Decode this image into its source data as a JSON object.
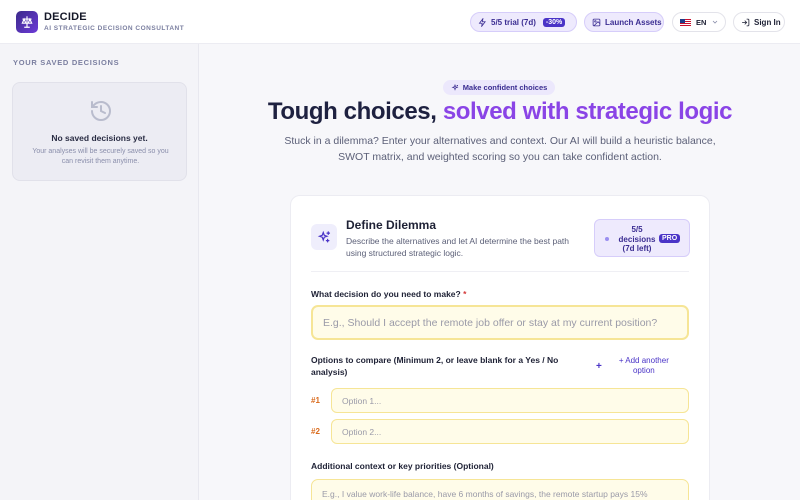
{
  "header": {
    "brand_name": "DECIDE",
    "brand_tagline": "AI STRATEGIC DECISION CONSULTANT",
    "trial_label": "5/5 trial (7d)",
    "trial_discount": "-30%",
    "launch_assets_label": "Launch Assets",
    "language_code": "EN",
    "sign_in_label": "Sign In"
  },
  "sidebar": {
    "title": "YOUR SAVED DECISIONS",
    "empty_title": "No saved decisions yet.",
    "empty_description": "Your analyses will be securely saved so you can revisit them anytime."
  },
  "hero": {
    "pill_label": "Make confident choices",
    "title_part1": "Tough choices,",
    "title_part2": "solved with strategic logic",
    "subtitle": "Stuck in a dilemma? Enter your alternatives and context. Our AI will build a heuristic balance, SWOT matrix, and weighted scoring so you can take confident action."
  },
  "card": {
    "title": "Define Dilemma",
    "description": "Describe the alternatives and let AI determine the best path using structured strategic logic.",
    "quota_label": "5/5 decisions (7d left)",
    "quota_badge": "PRO",
    "decision_label": "What decision do you need to make?",
    "decision_required_mark": "*",
    "decision_placeholder": "E.g., Should I accept the remote job offer or stay at my current position?",
    "options_label": "Options to compare (Minimum 2, or leave blank for a Yes / No analysis)",
    "add_option_label": "+ Add another option",
    "options": [
      {
        "number": "#1",
        "placeholder": "Option 1..."
      },
      {
        "number": "#2",
        "placeholder": "Option 2..."
      }
    ],
    "context_label": "Additional context or key priorities (Optional)",
    "context_placeholder": "E.g., I value work-life balance, have 6 months of savings, the remote startup pays 15%"
  },
  "colors": {
    "accent": "#4a34c7",
    "gradient_title": "#8a44e6",
    "input_background": "#fffce9",
    "input_border": "#f6e596"
  }
}
